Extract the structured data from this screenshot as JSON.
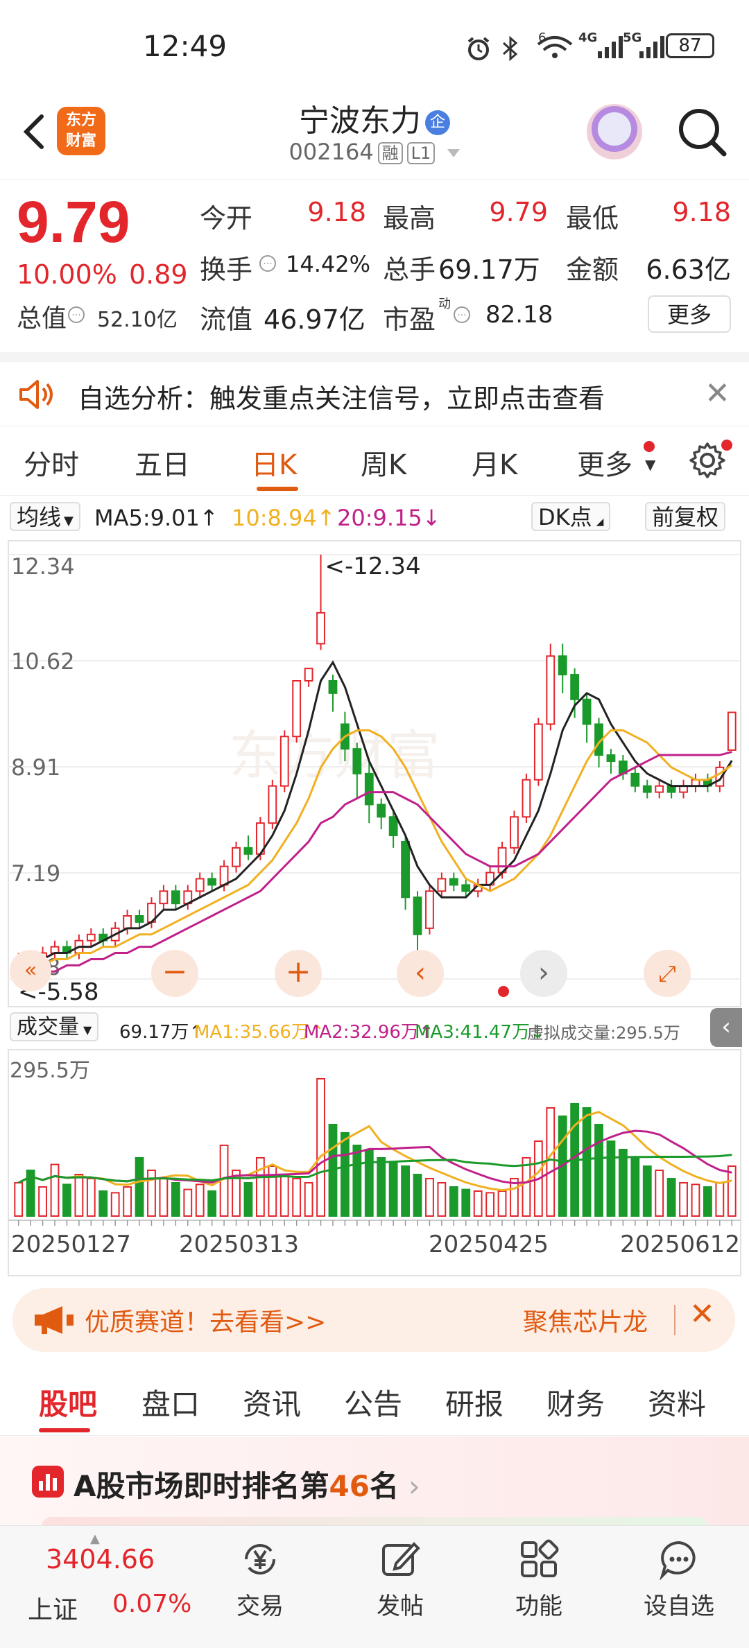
{
  "status_bar": {
    "time": "12:49",
    "battery": "87",
    "icons": [
      "alarm-icon",
      "bluetooth-icon",
      "wifi-icon",
      "signal-4g-icon",
      "signal-5g-icon",
      "battery-icon"
    ],
    "wifi_tag": "6",
    "net1_tag": "4G",
    "net2_tag": "5G"
  },
  "header": {
    "logo_line1": "东方",
    "logo_line2": "财富",
    "stock_name": "宁波东力",
    "badge": "企",
    "stock_code": "002164",
    "tag_margin": "融",
    "tag_level": "L1"
  },
  "quote": {
    "price": "9.79",
    "change_pct": "10.00%",
    "change_amt": "0.89",
    "total_value_label": "总值",
    "total_value": "52.10亿",
    "open_label": "今开",
    "open": "9.18",
    "high_label": "最高",
    "high": "9.79",
    "low_label": "最低",
    "low": "9.18",
    "turnover_label": "换手",
    "turnover": "14.42%",
    "volume_label": "总手",
    "volume": "69.17万",
    "amount_label": "金额",
    "amount": "6.63亿",
    "float_label": "流值",
    "float_value": "46.97亿",
    "pe_label": "市盈",
    "pe_sup": "动",
    "pe": "82.18",
    "more_label": "更多",
    "up_color": "#e2262c"
  },
  "alert": {
    "text": "自选分析：触发重点关注信号，立即点击查看"
  },
  "chart_tabs": [
    "分时",
    "五日",
    "日K",
    "周K",
    "月K",
    "更多"
  ],
  "chart_tabs_active": "日K",
  "ma_bar": {
    "selector": "均线",
    "ma5": "MA5:9.01",
    "ma10": "10:8.94",
    "ma20": "20:9.15",
    "dk": "DK点",
    "adjust": "前复权"
  },
  "volume_bar": {
    "selector": "成交量",
    "vol": "69.17万",
    "ma1": "MA1:35.66万",
    "ma2": "MA2:32.96万",
    "ma3": "MA3:41.47万",
    "virtual": "虚拟成交量:295.5万"
  },
  "chart_data": {
    "type": "candlestick",
    "price_axis": [
      "12.34",
      "10.62",
      "8.91",
      "7.19",
      "5.48"
    ],
    "ylim": [
      5.48,
      12.34
    ],
    "max_marker": "<-12.34",
    "min_marker": "5.58",
    "volume_axis_max": "295.5万",
    "dates": [
      "20250127",
      "20250313",
      "20250425",
      "20250612"
    ],
    "candles": [
      [
        5.6,
        5.8,
        5.5,
        5.9
      ],
      [
        5.8,
        5.7,
        5.6,
        5.9
      ],
      [
        5.7,
        5.9,
        5.6,
        6.0
      ],
      [
        5.9,
        6.0,
        5.8,
        6.1
      ],
      [
        6.0,
        5.9,
        5.8,
        6.1
      ],
      [
        5.9,
        6.1,
        5.8,
        6.2
      ],
      [
        6.1,
        6.2,
        6.0,
        6.3
      ],
      [
        6.2,
        6.1,
        6.0,
        6.3
      ],
      [
        6.1,
        6.3,
        6.0,
        6.4
      ],
      [
        6.3,
        6.5,
        6.2,
        6.6
      ],
      [
        6.5,
        6.4,
        6.3,
        6.6
      ],
      [
        6.4,
        6.7,
        6.3,
        6.8
      ],
      [
        6.7,
        6.9,
        6.6,
        7.0
      ],
      [
        6.9,
        6.7,
        6.6,
        7.0
      ],
      [
        6.7,
        6.9,
        6.6,
        7.0
      ],
      [
        6.9,
        7.1,
        6.8,
        7.2
      ],
      [
        7.1,
        7.0,
        6.9,
        7.2
      ],
      [
        7.0,
        7.3,
        6.9,
        7.4
      ],
      [
        7.3,
        7.6,
        7.2,
        7.7
      ],
      [
        7.6,
        7.5,
        7.4,
        7.8
      ],
      [
        7.5,
        8.0,
        7.4,
        8.1
      ],
      [
        8.0,
        8.6,
        7.9,
        8.7
      ],
      [
        8.6,
        9.4,
        8.5,
        9.5
      ],
      [
        9.4,
        10.3,
        9.3,
        10.3
      ],
      [
        10.3,
        10.5,
        10.2,
        10.5
      ],
      [
        10.9,
        11.4,
        10.8,
        12.34
      ],
      [
        10.3,
        10.1,
        9.8,
        10.4
      ],
      [
        9.6,
        9.2,
        9.0,
        9.8
      ],
      [
        9.2,
        8.8,
        8.4,
        9.3
      ],
      [
        8.8,
        8.3,
        8.0,
        9.0
      ],
      [
        8.3,
        8.1,
        7.9,
        8.4
      ],
      [
        8.1,
        7.8,
        7.6,
        8.2
      ],
      [
        7.7,
        6.8,
        6.6,
        7.8
      ],
      [
        6.8,
        6.2,
        5.8,
        6.9
      ],
      [
        6.3,
        6.9,
        6.2,
        7.0
      ],
      [
        6.9,
        7.1,
        6.8,
        7.2
      ],
      [
        7.1,
        7.0,
        6.9,
        7.2
      ],
      [
        7.0,
        6.9,
        6.8,
        7.1
      ],
      [
        6.9,
        7.0,
        6.8,
        7.1
      ],
      [
        7.0,
        7.2,
        6.9,
        7.3
      ],
      [
        7.2,
        7.6,
        7.1,
        7.7
      ],
      [
        7.6,
        8.1,
        7.5,
        8.2
      ],
      [
        8.1,
        8.7,
        8.0,
        8.8
      ],
      [
        8.7,
        9.6,
        8.6,
        9.7
      ],
      [
        9.6,
        10.7,
        9.5,
        10.9
      ],
      [
        10.7,
        10.4,
        10.1,
        10.9
      ],
      [
        10.4,
        10.0,
        9.7,
        10.5
      ],
      [
        10.0,
        9.6,
        9.3,
        10.1
      ],
      [
        9.6,
        9.1,
        8.9,
        9.7
      ],
      [
        9.1,
        9.0,
        8.8,
        9.2
      ],
      [
        9.0,
        8.8,
        8.7,
        9.1
      ],
      [
        8.8,
        8.6,
        8.5,
        8.9
      ],
      [
        8.6,
        8.5,
        8.4,
        8.7
      ],
      [
        8.5,
        8.6,
        8.4,
        8.7
      ],
      [
        8.6,
        8.5,
        8.4,
        8.7
      ],
      [
        8.5,
        8.6,
        8.4,
        8.7
      ],
      [
        8.6,
        8.7,
        8.5,
        8.8
      ],
      [
        8.7,
        8.6,
        8.5,
        8.8
      ],
      [
        8.6,
        8.9,
        8.5,
        9.0
      ],
      [
        9.18,
        9.79,
        9.18,
        9.79
      ]
    ],
    "ma5": [
      5.7,
      5.8,
      5.8,
      5.9,
      5.9,
      6.0,
      6.0,
      6.1,
      6.2,
      6.3,
      6.3,
      6.4,
      6.6,
      6.6,
      6.7,
      6.8,
      6.9,
      7.0,
      7.1,
      7.3,
      7.5,
      7.8,
      8.2,
      8.8,
      9.5,
      10.3,
      10.6,
      10.2,
      9.6,
      9.0,
      8.6,
      8.2,
      7.8,
      7.3,
      7.0,
      6.8,
      6.8,
      6.8,
      7.0,
      7.0,
      7.2,
      7.4,
      7.8,
      8.2,
      8.8,
      9.5,
      9.9,
      10.1,
      10.0,
      9.6,
      9.3,
      9.0,
      8.8,
      8.7,
      8.6,
      8.6,
      8.6,
      8.6,
      8.7,
      9.01
    ],
    "ma10": [
      5.6,
      5.7,
      5.7,
      5.8,
      5.8,
      5.9,
      5.9,
      6.0,
      6.0,
      6.1,
      6.2,
      6.2,
      6.3,
      6.4,
      6.5,
      6.6,
      6.7,
      6.8,
      6.9,
      7.0,
      7.2,
      7.4,
      7.7,
      8.0,
      8.4,
      8.9,
      9.2,
      9.4,
      9.5,
      9.5,
      9.4,
      9.2,
      8.9,
      8.5,
      8.1,
      7.7,
      7.4,
      7.1,
      7.0,
      6.9,
      7.0,
      7.1,
      7.3,
      7.5,
      7.8,
      8.2,
      8.6,
      9.0,
      9.3,
      9.5,
      9.5,
      9.4,
      9.3,
      9.1,
      8.9,
      8.8,
      8.7,
      8.7,
      8.8,
      8.94
    ],
    "ma20": [
      5.5,
      5.5,
      5.6,
      5.6,
      5.7,
      5.7,
      5.8,
      5.8,
      5.9,
      5.9,
      6.0,
      6.0,
      6.1,
      6.2,
      6.3,
      6.4,
      6.5,
      6.6,
      6.7,
      6.8,
      6.9,
      7.1,
      7.3,
      7.5,
      7.7,
      8.0,
      8.1,
      8.3,
      8.4,
      8.5,
      8.5,
      8.5,
      8.4,
      8.3,
      8.1,
      7.9,
      7.7,
      7.5,
      7.4,
      7.3,
      7.3,
      7.3,
      7.4,
      7.5,
      7.7,
      7.9,
      8.1,
      8.3,
      8.5,
      8.7,
      8.8,
      8.9,
      9.0,
      9.1,
      9.1,
      9.1,
      9.1,
      9.1,
      9.1,
      9.15
    ],
    "volumes": [
      40,
      55,
      35,
      62,
      38,
      50,
      45,
      30,
      28,
      35,
      70,
      55,
      45,
      40,
      32,
      38,
      30,
      85,
      55,
      40,
      70,
      60,
      50,
      45,
      40,
      165,
      110,
      100,
      85,
      80,
      70,
      65,
      60,
      50,
      45,
      40,
      35,
      32,
      30,
      28,
      30,
      45,
      70,
      90,
      130,
      120,
      135,
      130,
      110,
      90,
      80,
      70,
      60,
      55,
      45,
      40,
      38,
      35,
      40,
      60
    ]
  },
  "chart_controls": [
    "rewind-icon",
    "zoom-out-icon",
    "zoom-in-icon",
    "prev-icon",
    "next-icon",
    "fullscreen-icon"
  ],
  "banner": {
    "left_text": "优质赛道！去看看>>",
    "right_text": "聚焦芯片龙"
  },
  "content_tabs": [
    "股吧",
    "盘口",
    "资讯",
    "公告",
    "研报",
    "财务",
    "资料"
  ],
  "content_tabs_active": "股吧",
  "ranking": {
    "prefix": "A股市场即时排名第",
    "rank": "46",
    "suffix": "名"
  },
  "bottom_nav": {
    "index_value": "3404.66",
    "index_name": "上证",
    "index_change": "0.07%",
    "items": [
      "交易",
      "发帖",
      "功能",
      "设自选"
    ]
  },
  "colors": {
    "accent": "#e05a10",
    "up": "#e2262c",
    "down": "#1a9a2a",
    "ma5": "#222222",
    "ma10": "#f0b020",
    "ma20": "#c0208a",
    "vol_ma3": "#1a9a2a"
  }
}
